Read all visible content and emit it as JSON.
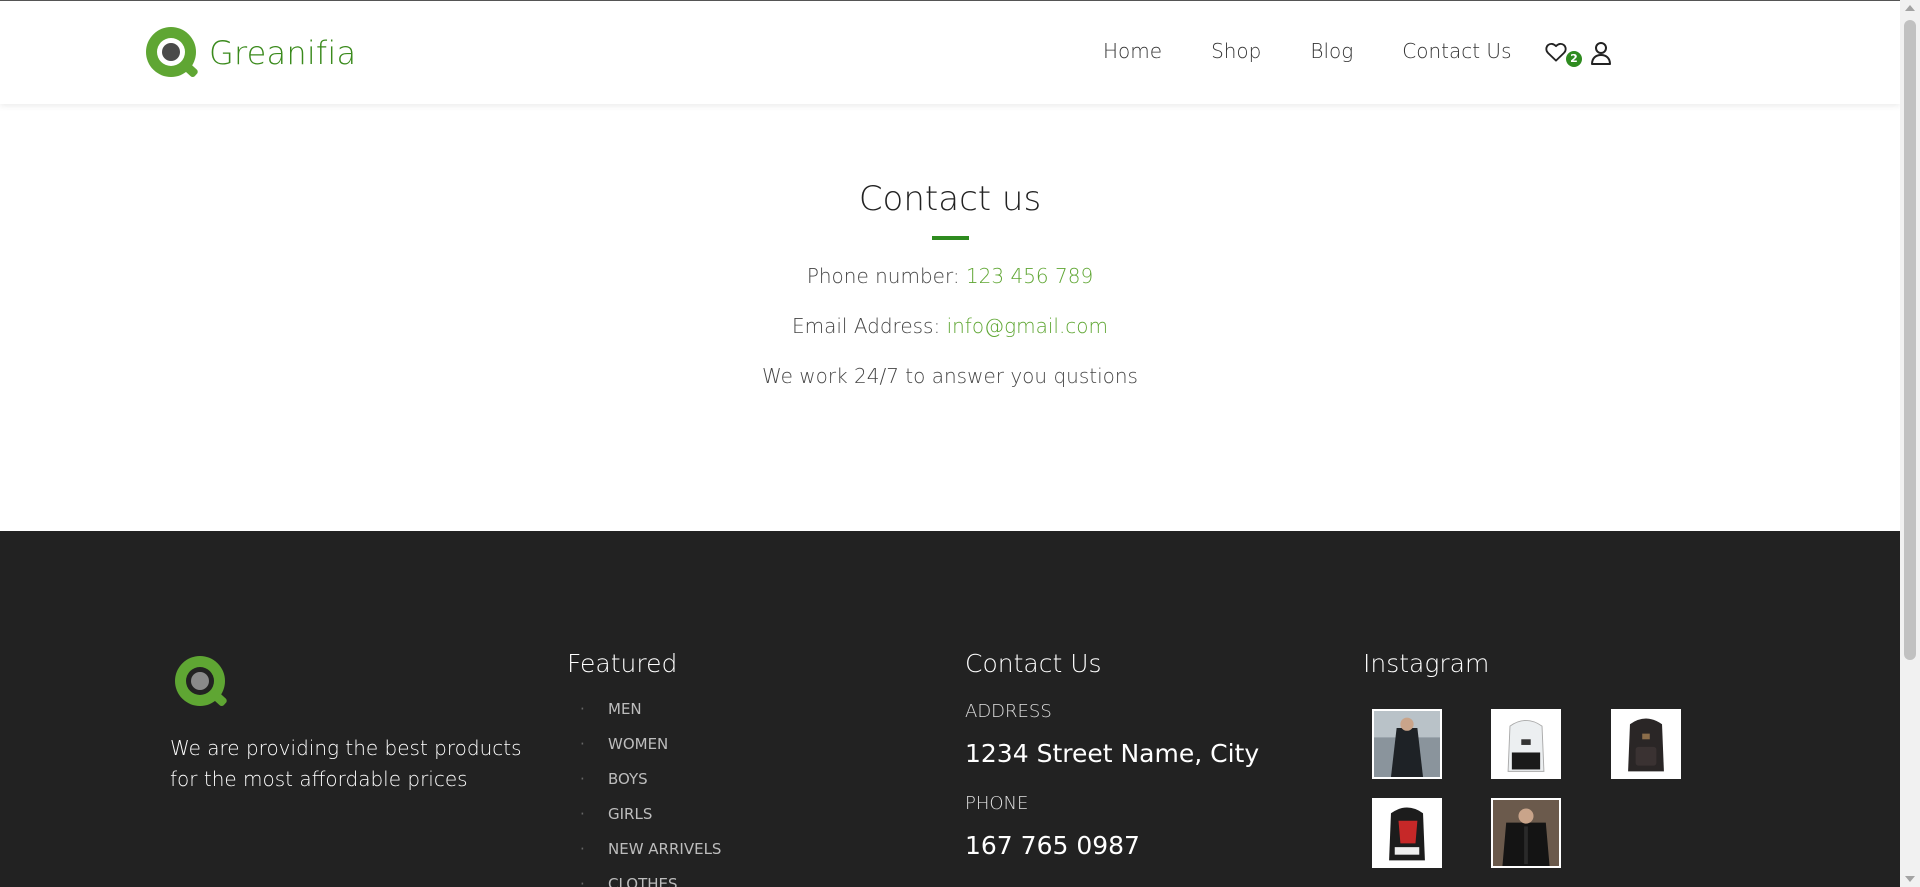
{
  "brand": {
    "name": "Greanifia",
    "color": "#3a8a1c",
    "accent": "#5fa633"
  },
  "nav": {
    "links": [
      "Home",
      "Shop",
      "Blog",
      "Contact Us"
    ],
    "wishlist_count": "2",
    "icons": [
      "heart-icon",
      "user-icon"
    ]
  },
  "contact": {
    "title": "Contact us",
    "phone_label": "Phone number:",
    "phone_value": "123 456 789",
    "email_label": "Email Address:",
    "email_value": "info@gmail.com",
    "note": "We work 24/7 to answer you qustions"
  },
  "footer": {
    "about": "We are providing the best products for the most affordable prices",
    "featured_title": "Featured",
    "featured_items": [
      "MEN",
      "WOMEN",
      "BOYS",
      "GIRLS",
      "NEW ARRIVELS",
      "CLOTHES"
    ],
    "contact_title": "Contact Us",
    "address_label": "ADDRESS",
    "address_value": "1234 Street Name, City",
    "phone_label": "PHONE",
    "phone_value": "167 765 0987",
    "instagram_title": "Instagram",
    "instagram_posts": [
      "dark-coat-photo",
      "white-backpack-photo",
      "black-backpack-photo",
      "red-backpack-photo",
      "black-jacket-photo"
    ]
  }
}
